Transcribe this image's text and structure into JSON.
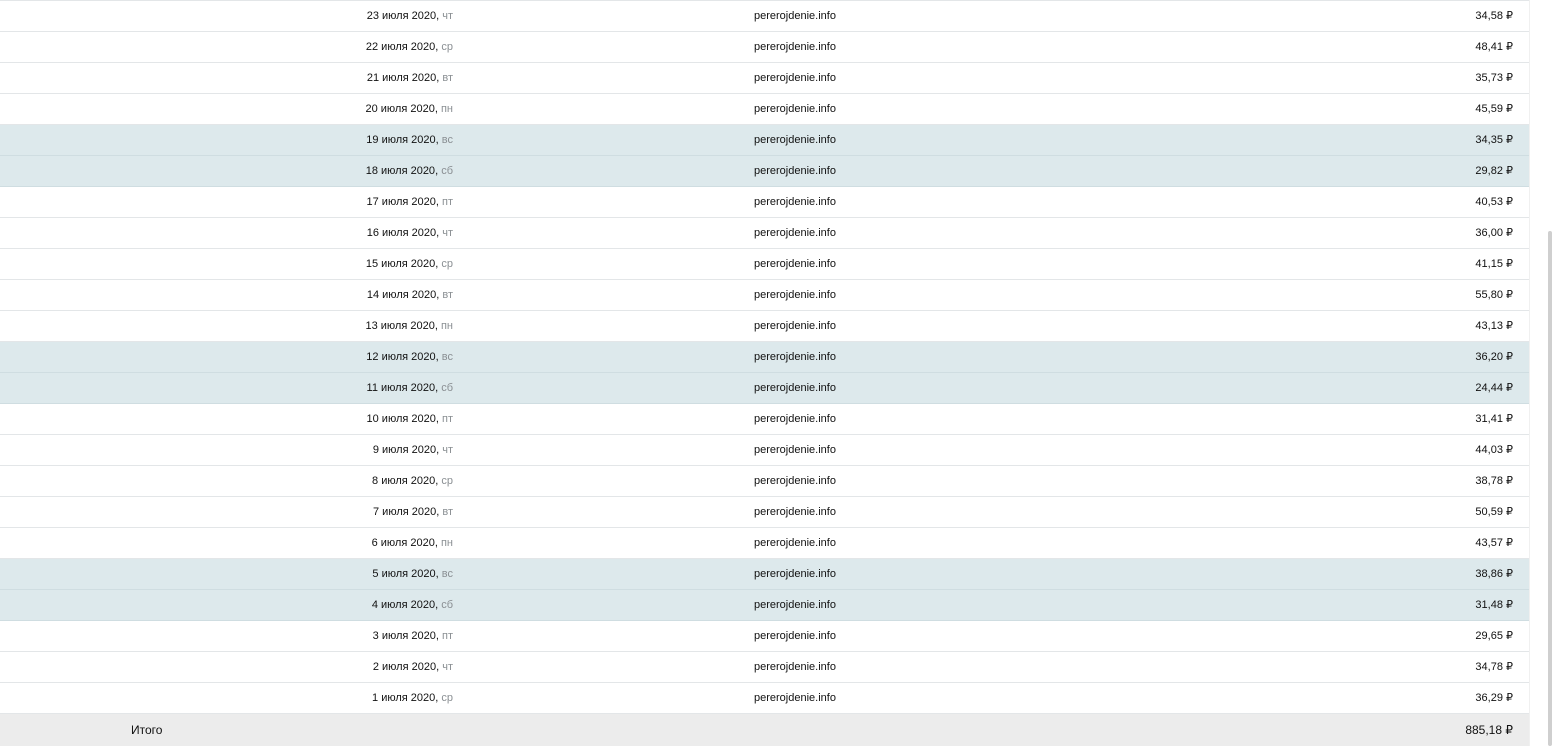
{
  "rows": [
    {
      "date": "23 июля 2020",
      "dow": "чт",
      "site": "pererojdenie.info",
      "amount": "34,58 ₽",
      "weekend": false
    },
    {
      "date": "22 июля 2020",
      "dow": "ср",
      "site": "pererojdenie.info",
      "amount": "48,41 ₽",
      "weekend": false
    },
    {
      "date": "21 июля 2020",
      "dow": "вт",
      "site": "pererojdenie.info",
      "amount": "35,73 ₽",
      "weekend": false
    },
    {
      "date": "20 июля 2020",
      "dow": "пн",
      "site": "pererojdenie.info",
      "amount": "45,59 ₽",
      "weekend": false
    },
    {
      "date": "19 июля 2020",
      "dow": "вс",
      "site": "pererojdenie.info",
      "amount": "34,35 ₽",
      "weekend": true
    },
    {
      "date": "18 июля 2020",
      "dow": "сб",
      "site": "pererojdenie.info",
      "amount": "29,82 ₽",
      "weekend": true
    },
    {
      "date": "17 июля 2020",
      "dow": "пт",
      "site": "pererojdenie.info",
      "amount": "40,53 ₽",
      "weekend": false
    },
    {
      "date": "16 июля 2020",
      "dow": "чт",
      "site": "pererojdenie.info",
      "amount": "36,00 ₽",
      "weekend": false
    },
    {
      "date": "15 июля 2020",
      "dow": "ср",
      "site": "pererojdenie.info",
      "amount": "41,15 ₽",
      "weekend": false
    },
    {
      "date": "14 июля 2020",
      "dow": "вт",
      "site": "pererojdenie.info",
      "amount": "55,80 ₽",
      "weekend": false
    },
    {
      "date": "13 июля 2020",
      "dow": "пн",
      "site": "pererojdenie.info",
      "amount": "43,13 ₽",
      "weekend": false
    },
    {
      "date": "12 июля 2020",
      "dow": "вс",
      "site": "pererojdenie.info",
      "amount": "36,20 ₽",
      "weekend": true
    },
    {
      "date": "11 июля 2020",
      "dow": "сб",
      "site": "pererojdenie.info",
      "amount": "24,44 ₽",
      "weekend": true
    },
    {
      "date": "10 июля 2020",
      "dow": "пт",
      "site": "pererojdenie.info",
      "amount": "31,41 ₽",
      "weekend": false
    },
    {
      "date": "9 июля 2020",
      "dow": "чт",
      "site": "pererojdenie.info",
      "amount": "44,03 ₽",
      "weekend": false
    },
    {
      "date": "8 июля 2020",
      "dow": "ср",
      "site": "pererojdenie.info",
      "amount": "38,78 ₽",
      "weekend": false
    },
    {
      "date": "7 июля 2020",
      "dow": "вт",
      "site": "pererojdenie.info",
      "amount": "50,59 ₽",
      "weekend": false
    },
    {
      "date": "6 июля 2020",
      "dow": "пн",
      "site": "pererojdenie.info",
      "amount": "43,57 ₽",
      "weekend": false
    },
    {
      "date": "5 июля 2020",
      "dow": "вс",
      "site": "pererojdenie.info",
      "amount": "38,86 ₽",
      "weekend": true
    },
    {
      "date": "4 июля 2020",
      "dow": "сб",
      "site": "pererojdenie.info",
      "amount": "31,48 ₽",
      "weekend": true
    },
    {
      "date": "3 июля 2020",
      "dow": "пт",
      "site": "pererojdenie.info",
      "amount": "29,65 ₽",
      "weekend": false
    },
    {
      "date": "2 июля 2020",
      "dow": "чт",
      "site": "pererojdenie.info",
      "amount": "34,78 ₽",
      "weekend": false
    },
    {
      "date": "1 июля 2020",
      "dow": "ср",
      "site": "pererojdenie.info",
      "amount": "36,29 ₽",
      "weekend": false
    }
  ],
  "total": {
    "label": "Итого",
    "amount": "885,18 ₽"
  },
  "colors": {
    "weekend_row": "#dde9ec",
    "total_row": "#ececec",
    "weekday_text": "#8a8f93"
  }
}
